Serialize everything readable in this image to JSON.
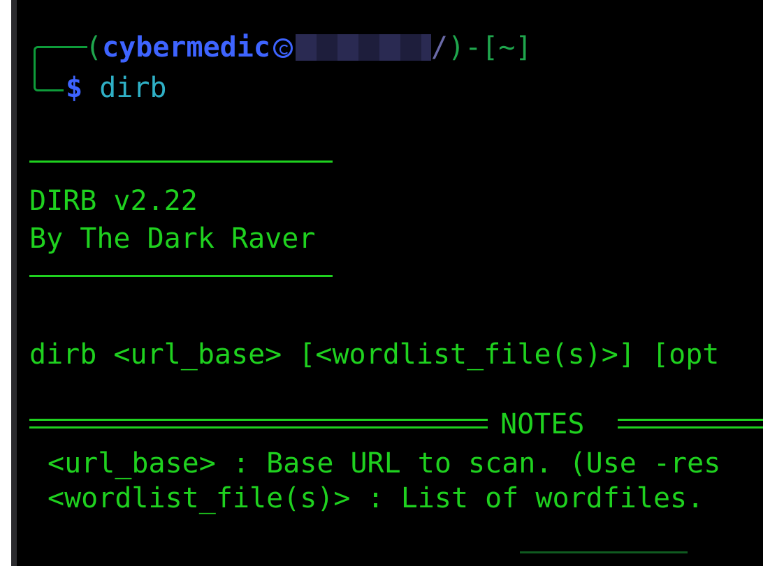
{
  "terminal": {
    "prompt": {
      "open_paren": "(",
      "username": "cybermedic",
      "hostname_visible_tail": "/",
      "close_segment": ")-[",
      "cwd": "~",
      "close_bracket": "]",
      "dollar": "$",
      "command": "dirb"
    },
    "output": {
      "title": "DIRB v2.22",
      "author": "By The Dark Raver",
      "usage": "dirb <url_base> [<wordlist_file(s)>] [opt",
      "notes_header": "NOTES",
      "notes": [
        "<url_base> : Base URL to scan. (Use -res",
        "<wordlist_file(s)> : List of wordfiles."
      ]
    },
    "colors": {
      "background": "#000000",
      "text": "#1fd11f",
      "username": "#3e64ff",
      "command": "#2fb0c6"
    },
    "icons": {
      "prompt_symbol": "kali-dragon-icon"
    }
  }
}
